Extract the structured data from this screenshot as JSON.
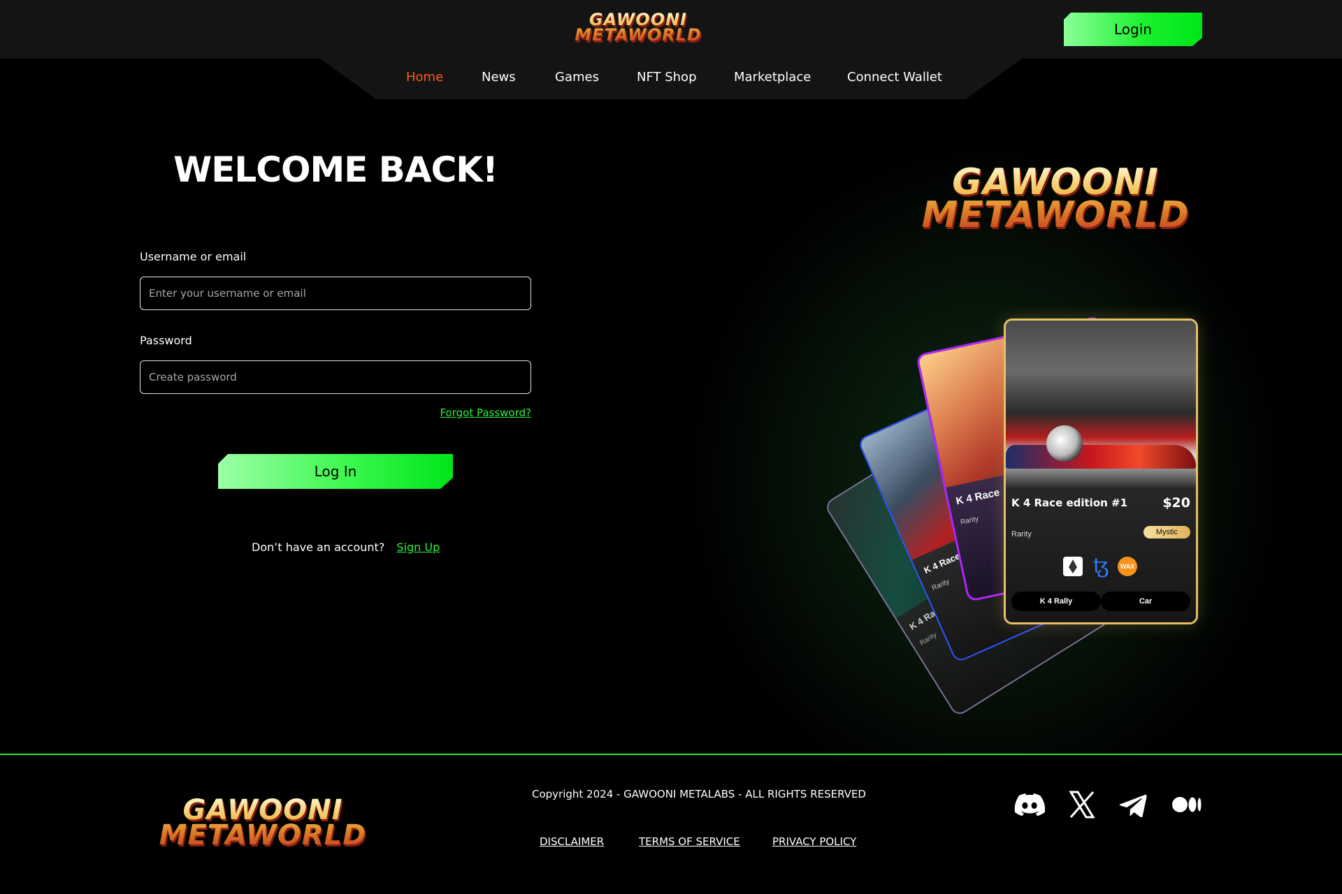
{
  "header": {
    "logo_line1": "GAWOONI",
    "logo_line2": "METAWORLD",
    "login_label": "Login"
  },
  "nav": {
    "items": [
      "Home",
      "News",
      "Games",
      "NFT Shop",
      "Marketplace",
      "Connect Wallet"
    ],
    "active": "Home"
  },
  "login_form": {
    "title": "WELCOME BACK!",
    "username_label": "Username or email",
    "username_placeholder": "Enter your username or email",
    "username_value": "",
    "password_label": "Password",
    "password_placeholder": "Create password",
    "password_value": "",
    "forgot_label": "Forgot Password?",
    "submit_label": "Log In",
    "signup_prompt": "Don’t have an account?",
    "signup_link": "Sign Up"
  },
  "hero": {
    "logo_line1": "GAWOONI",
    "logo_line2": "METAWORLD",
    "card": {
      "title": "K 4 Race edition #1",
      "price": "$20",
      "rarity_label": "Rarity",
      "rarity_value": "Mystic",
      "chains": [
        "ethereum-icon",
        "tezos-icon",
        "wax-icon"
      ],
      "wax_label": "WAX",
      "tags": [
        "K 4 Rally",
        "Car"
      ]
    },
    "back_cards": [
      {
        "title": "K 4 Race",
        "rarity_label": "Rarity"
      },
      {
        "title": "K 4 Race e",
        "rarity_label": "Rarity"
      },
      {
        "title": "K 4 Race edition #1",
        "rarity_label": "Rarity"
      }
    ]
  },
  "footer": {
    "logo_line1": "GAWOONI",
    "logo_line2": "METAWORLD",
    "copyright": "Copyright 2024 - GAWOONI METALABS - ALL RIGHTS RESERVED",
    "links": [
      "DISCLAIMER",
      "TERMS OF SERVICE",
      "PRIVACY POLICY"
    ],
    "social": [
      "discord-icon",
      "x-icon",
      "telegram-icon",
      "medium-icon"
    ]
  },
  "colors": {
    "accent_green": "#2df23f",
    "nav_active": "#ff5a1f",
    "card_gold": "#e6c068"
  }
}
